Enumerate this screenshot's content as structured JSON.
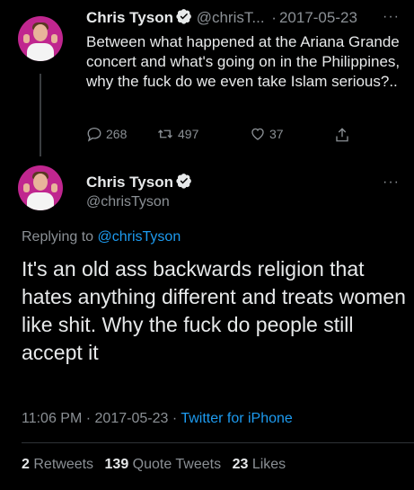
{
  "tweet1": {
    "name": "Chris Tyson",
    "handle_truncated": "@chrisT...",
    "separator": "·",
    "date": "2017-05-23",
    "more": "···",
    "text": "Between what happened at the Ariana Grande concert and what's going on in the Philippines, why the fuck do we even take Islam serious?..",
    "replies": "268",
    "retweets": "497",
    "likes": "37"
  },
  "tweet2": {
    "name": "Chris Tyson",
    "handle": "@chrisTyson",
    "more": "···",
    "replying_prefix": "Replying to ",
    "replying_handle": "@chrisTyson",
    "text": "It's an old ass backwards religion that hates anything different and treats women like shit. Why the fuck do people still accept it",
    "time": "11:06 PM",
    "separator": "·",
    "date": "2017-05-23",
    "source": "Twitter for iPhone",
    "retweets_count": "2",
    "retweets_label": "Retweets",
    "quotes_count": "139",
    "quotes_label": "Quote Tweets",
    "likes_count": "23",
    "likes_label": "Likes"
  },
  "colors": {
    "background": "#000000",
    "text": "#e7e9ea",
    "muted": "#8b9095",
    "link": "#1d9bf0",
    "verified_badge": "#e7e9ea",
    "avatar_bg": "#c0268f"
  },
  "icons": [
    "verified-badge-icon",
    "reply-icon",
    "retweet-icon",
    "like-icon",
    "share-icon",
    "more-icon"
  ]
}
